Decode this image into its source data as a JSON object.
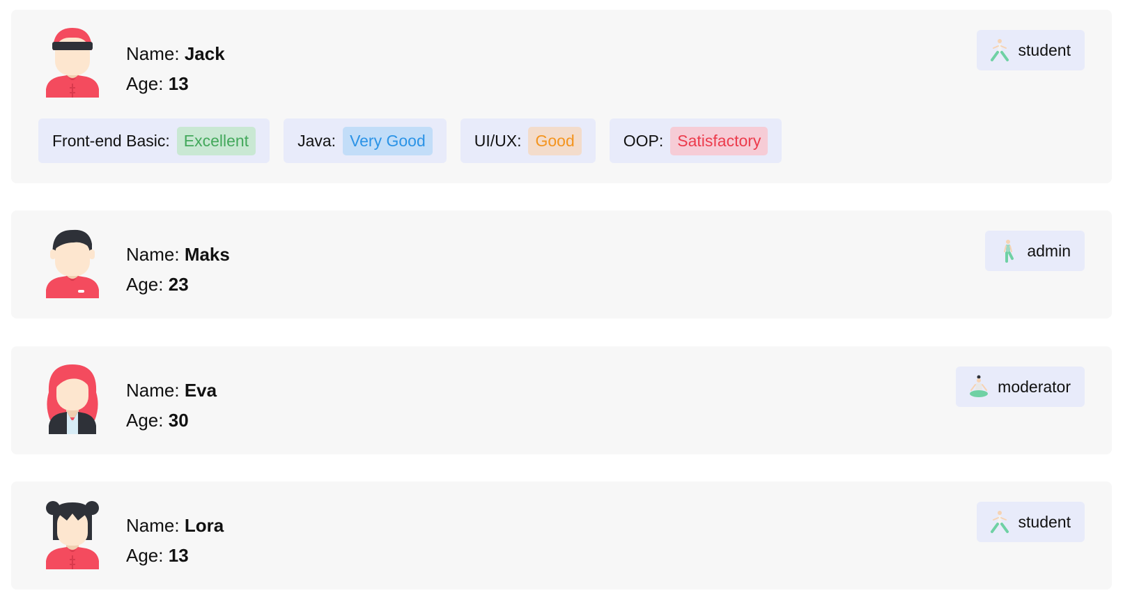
{
  "labels": {
    "name": "Name:",
    "age": "Age:"
  },
  "users": [
    {
      "name": "Jack",
      "age": "13",
      "role": "student",
      "role_icon": "student-icon",
      "avatar_icon": "boy-headband-avatar",
      "skills": [
        {
          "subject": "Front-end Basic:",
          "grade": "Excellent",
          "grade_color": "#43a85b"
        },
        {
          "subject": "Java:",
          "grade": "Very Good",
          "grade_color": "#2b93e6"
        },
        {
          "subject": "UI/UX:",
          "grade": "Good",
          "grade_color": "#f3941f"
        },
        {
          "subject": "OOP:",
          "grade": "Satisfactory",
          "grade_color": "#ec3b4c"
        }
      ]
    },
    {
      "name": "Maks",
      "age": "23",
      "role": "admin",
      "role_icon": "admin-icon",
      "avatar_icon": "man-avatar"
    },
    {
      "name": "Eva",
      "age": "30",
      "role": "moderator",
      "role_icon": "moderator-icon",
      "avatar_icon": "woman-red-hair-avatar"
    },
    {
      "name": "Lora",
      "age": "13",
      "role": "student",
      "role_icon": "student-icon",
      "avatar_icon": "girl-buns-avatar"
    }
  ],
  "colors": {
    "card_bg": "#f7f7f7",
    "badge_bg": "#e8ebfa",
    "avatar_red": "#f44b5e",
    "skin": "#fde6cf",
    "hair_dark": "#2e3138"
  }
}
